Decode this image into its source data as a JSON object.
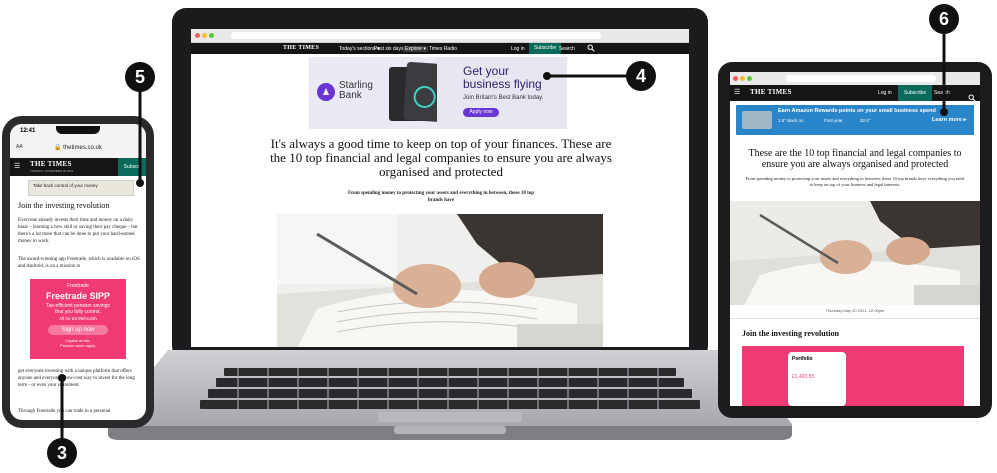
{
  "laptop": {
    "nav": {
      "brand": "THE TIMES",
      "items": [
        "Today's sections ▾",
        "Past six days",
        "Explore ▾",
        "Times Radio"
      ],
      "login": "Log in",
      "subscribe": "Subscribe",
      "search": "Search"
    },
    "ad": {
      "brand_line1": "Starling",
      "brand_line2": "Bank",
      "headline_line1": "Get your",
      "headline_line2": "business flying",
      "subline": "Join Britain's Best Bank today.",
      "cta": "Apply now"
    },
    "article": {
      "headline": "It's always a good time to keep on top of your finances. These are the 10 top financial and legal companies to ensure you are always organised and protected",
      "standfirst": "From spending money to protecting your assets and everything in between, these 10 top brands have"
    }
  },
  "phone": {
    "time": "12:41",
    "url": "thetimes.co.uk",
    "brand": "THE TIMES",
    "date_line": "TUESDAY NOVEMBER 30 2021",
    "subscribe": "Subscri",
    "ad_text": "Take back control of your money",
    "section_title": "Join the investing revolution",
    "para1": "Everyone already invests their time and money on a daily basis – learning a new skill or saving their pay cheque – but there's a lot more that can be done to put your hard-earned money to work.",
    "para2": "The award-winning app Freetrade, which is available on iOS and Android, is on a mission to",
    "freetrade": {
      "brand": "Freetrade",
      "title": "Freetrade SIPP",
      "line1": "Tax-efficient pension savings",
      "line2": "that you fully control.",
      "price": "All for £9.99/month",
      "cta": "Sign up now",
      "risk1": "Capital at risk.",
      "risk2": "Pension rules apply."
    },
    "para3": "get everyone investing with a unique platform that offers anyone and everyone a low-cost way to invest for the long term - or even your retirement.",
    "para4": "Through Freetrade you can trade in a personal"
  },
  "tablet": {
    "brand": "THE TIMES",
    "login": "Log in",
    "subscribe": "Subscribe",
    "search": "Search",
    "ad_title": "Earn Amazon Rewards points on your small business spend",
    "ad_cta": "Learn more ▸",
    "ad_col1": "1.5° Back on",
    "ad_col2": "First year",
    "ad_col3": "32.6°",
    "headline": "These are the 10 top financial and legal companies to ensure you are always organised and protected",
    "standfirst": "From spending money to protecting your assets and everything in between, these 10 top brands have everything you need to keep on top of your finances and legal interests.",
    "caption": "Thursday May 20 2021, 12.00pm",
    "section_title": "Join the investing revolution",
    "portfolio": "Portfolio",
    "amount": "£1,420.55"
  },
  "callouts": {
    "c3": "3",
    "c4": "4",
    "c5": "5",
    "c6": "6"
  },
  "colors": {
    "starling_purple": "#6935d3",
    "times_green": "#0a6b5b",
    "freetrade_pink": "#ef3a73",
    "amazon_blue": "#2a86c9"
  }
}
